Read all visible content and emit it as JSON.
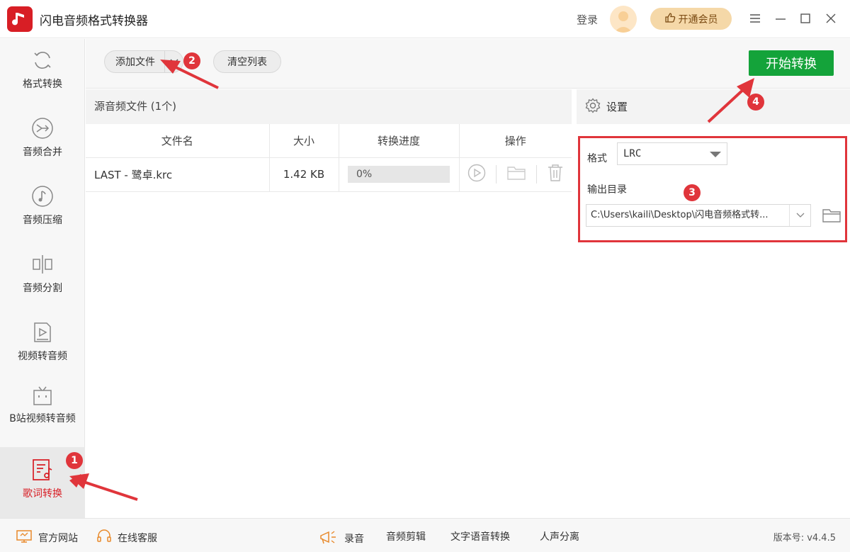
{
  "app": {
    "title": "闪电音频格式转换器",
    "login_label": "登录",
    "vip_label": "开通会员"
  },
  "sidebar": {
    "items": [
      {
        "label": "格式转换",
        "icon": "refresh-icon"
      },
      {
        "label": "音频合并",
        "icon": "merge-icon"
      },
      {
        "label": "音频压缩",
        "icon": "music-note-icon"
      },
      {
        "label": "音频分割",
        "icon": "split-icon"
      },
      {
        "label": "视频转音频",
        "icon": "video-play-icon"
      },
      {
        "label": "B站视频转音频",
        "icon": "bilibili-tv-icon"
      },
      {
        "label": "歌词转换",
        "icon": "lyrics-icon",
        "active": true
      }
    ]
  },
  "toolbar": {
    "add_file_label": "添加文件",
    "clear_list_label": "清空列表",
    "start_label": "开始转换"
  },
  "file_panel": {
    "header": "源音频文件 (1个)",
    "columns": [
      "文件名",
      "大小",
      "转换进度",
      "操作"
    ],
    "rows": [
      {
        "name": "LAST - 鹭卓.krc",
        "size": "1.42 KB",
        "progress": "0%",
        "progress_value": 0
      }
    ]
  },
  "settings": {
    "header": "设置",
    "format_label": "格式",
    "format_value": "LRC",
    "output_label": "输出目录",
    "output_path": "C:\\Users\\kaili\\Desktop\\闪电音频格式转..."
  },
  "footer": {
    "website": "官方网站",
    "support": "在线客服",
    "record": "录音",
    "audio_edit": "音频剪辑",
    "tts": "文字语音转换",
    "vocal_sep": "人声分离",
    "version": "版本号: v4.4.5"
  },
  "annotations": {
    "badge1": "1",
    "badge2": "2",
    "badge3": "3",
    "badge4": "4"
  },
  "colors": {
    "brand_red": "#d81e25",
    "start_green": "#14a33a",
    "annotation_red": "#e0353b",
    "vip_gold": "#f5d8a8"
  }
}
